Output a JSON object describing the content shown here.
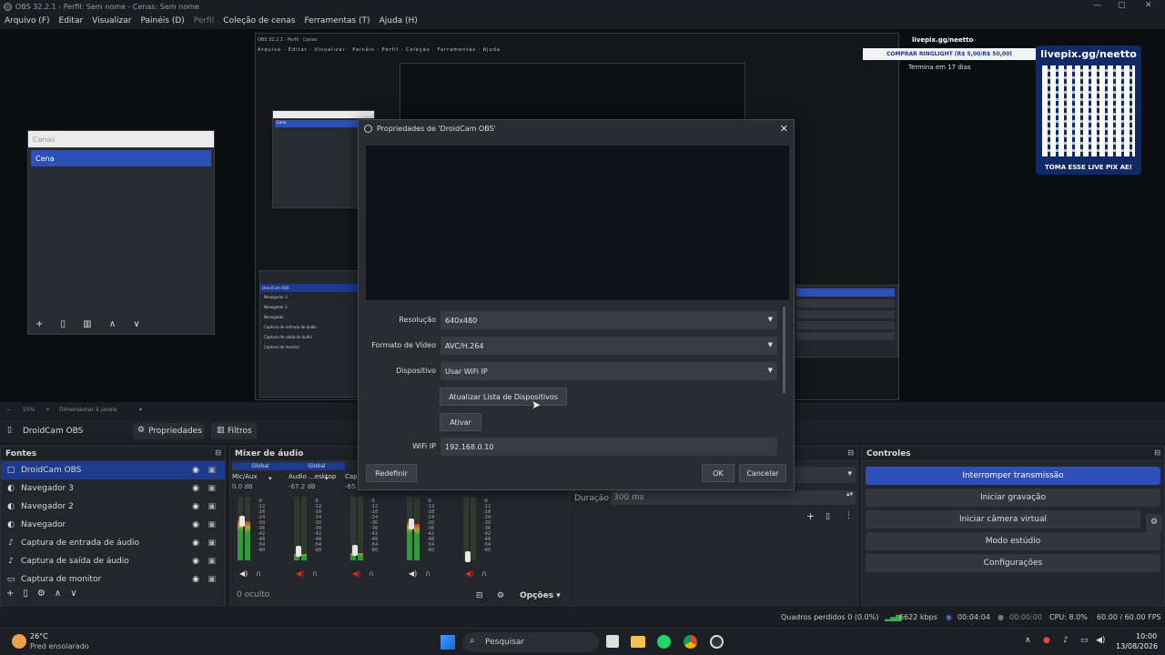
{
  "window": {
    "title": "OBS 32.2.1 - Perfil: Sem nome - Cenas: Sem nome",
    "minimize": "—",
    "maximize": "▢",
    "close": "✕"
  },
  "menu": [
    "Arquivo (F)",
    "Editar",
    "Visualizar",
    "Painéis (D)",
    "Perfil",
    "Coleção de cenas",
    "Ferramentas (T)",
    "Ajuda (H)"
  ],
  "preview": {
    "scenes_panel_title": "Cenas",
    "scene_item": "Cena",
    "livepix_url": "livepix.gg/neetto",
    "donate_bar": "COMPRAR RINGLIGHT (R$ 5,00/R$ 50,00)",
    "qr_caption": "TOMA ESSE LIVE PIX AE!",
    "ends_text": "Termina em 17 dias",
    "small_livepix": "livepix.gg/neetto"
  },
  "zoombar": {
    "minus": "−",
    "zoom": "55%",
    "plus": "+",
    "mode": "Dimensionar à janela"
  },
  "source_toolbar": {
    "source_name": "DroidCam OBS",
    "properties": "Propriedades",
    "filters": "Filtros"
  },
  "sources": {
    "title": "Fontes",
    "items": [
      {
        "name": "DroidCam OBS",
        "icon": "□",
        "selected": true
      },
      {
        "name": "Navegador 3",
        "icon": "◐"
      },
      {
        "name": "Navegador 2",
        "icon": "◐"
      },
      {
        "name": "Navegador",
        "icon": "◐"
      },
      {
        "name": "Captura de entrada de áudio",
        "icon": "♪"
      },
      {
        "name": "Captura de saída de áudio",
        "icon": "♪"
      },
      {
        "name": "Captura de monitor",
        "icon": "▭"
      }
    ]
  },
  "mixer": {
    "title": "Mixer de áudio",
    "channels": [
      {
        "global": "Global",
        "name": "Mic/Aux",
        "db": "0.0 dB",
        "level": 0.65
      },
      {
        "global": "Global",
        "name": "Áudio ...esktop",
        "db": "-67.2 dB",
        "level": 0.1
      },
      {
        "global": "",
        "name": "Cap",
        "db": "-65.0 dB",
        "level": 0.12
      },
      {
        "global": "",
        "name": "",
        "db": "",
        "level": 0.6
      },
      {
        "global": "",
        "name": "",
        "db": "",
        "level": 0.0
      }
    ],
    "hidden": "0 oculto",
    "options": "Opções",
    "scale": [
      "-6",
      "-12",
      "-18",
      "-24",
      "-30",
      "-36",
      "-42",
      "-48",
      "-54",
      "-60"
    ]
  },
  "transitions": {
    "duration_label": "Duração",
    "duration_value": "300 ms"
  },
  "controls": {
    "title": "Controles",
    "buttons": [
      "Interromper transmissão",
      "Iniciar gravação",
      "Iniciar câmera virtual",
      "Modo estúdio",
      "Configurações"
    ]
  },
  "dialog": {
    "title": "Propriedades de 'DroidCam OBS'",
    "fields": [
      {
        "label": "Resolução",
        "value": "640x480"
      },
      {
        "label": "Formato de Vídeo",
        "value": "AVC/H.264"
      },
      {
        "label": "Dispositivo",
        "value": "Usar WiFi IP"
      }
    ],
    "refresh_button": "Atualizar Lista de Dispositivos",
    "activate_button": "Ativar",
    "wifi_label": "WiFi IP",
    "wifi_value": "192.168.0.10",
    "reset_button": "Redefinir",
    "ok_button": "OK",
    "cancel_button": "Cancelar"
  },
  "status": {
    "dropped": "Quadros perdidos 0 (0.0%)",
    "bitrate": "6622 kbps",
    "stream_time": "00:04:04",
    "rec_time": "00:00:00",
    "cpu": "CPU: 8.0%",
    "fps": "60.00 / 60.00 FPS"
  },
  "taskbar": {
    "weather_temp": "26°C",
    "weather_desc": "Pred ensolarado",
    "search": "Pesquisar",
    "time": "10:00",
    "date": "13/08/2026"
  }
}
